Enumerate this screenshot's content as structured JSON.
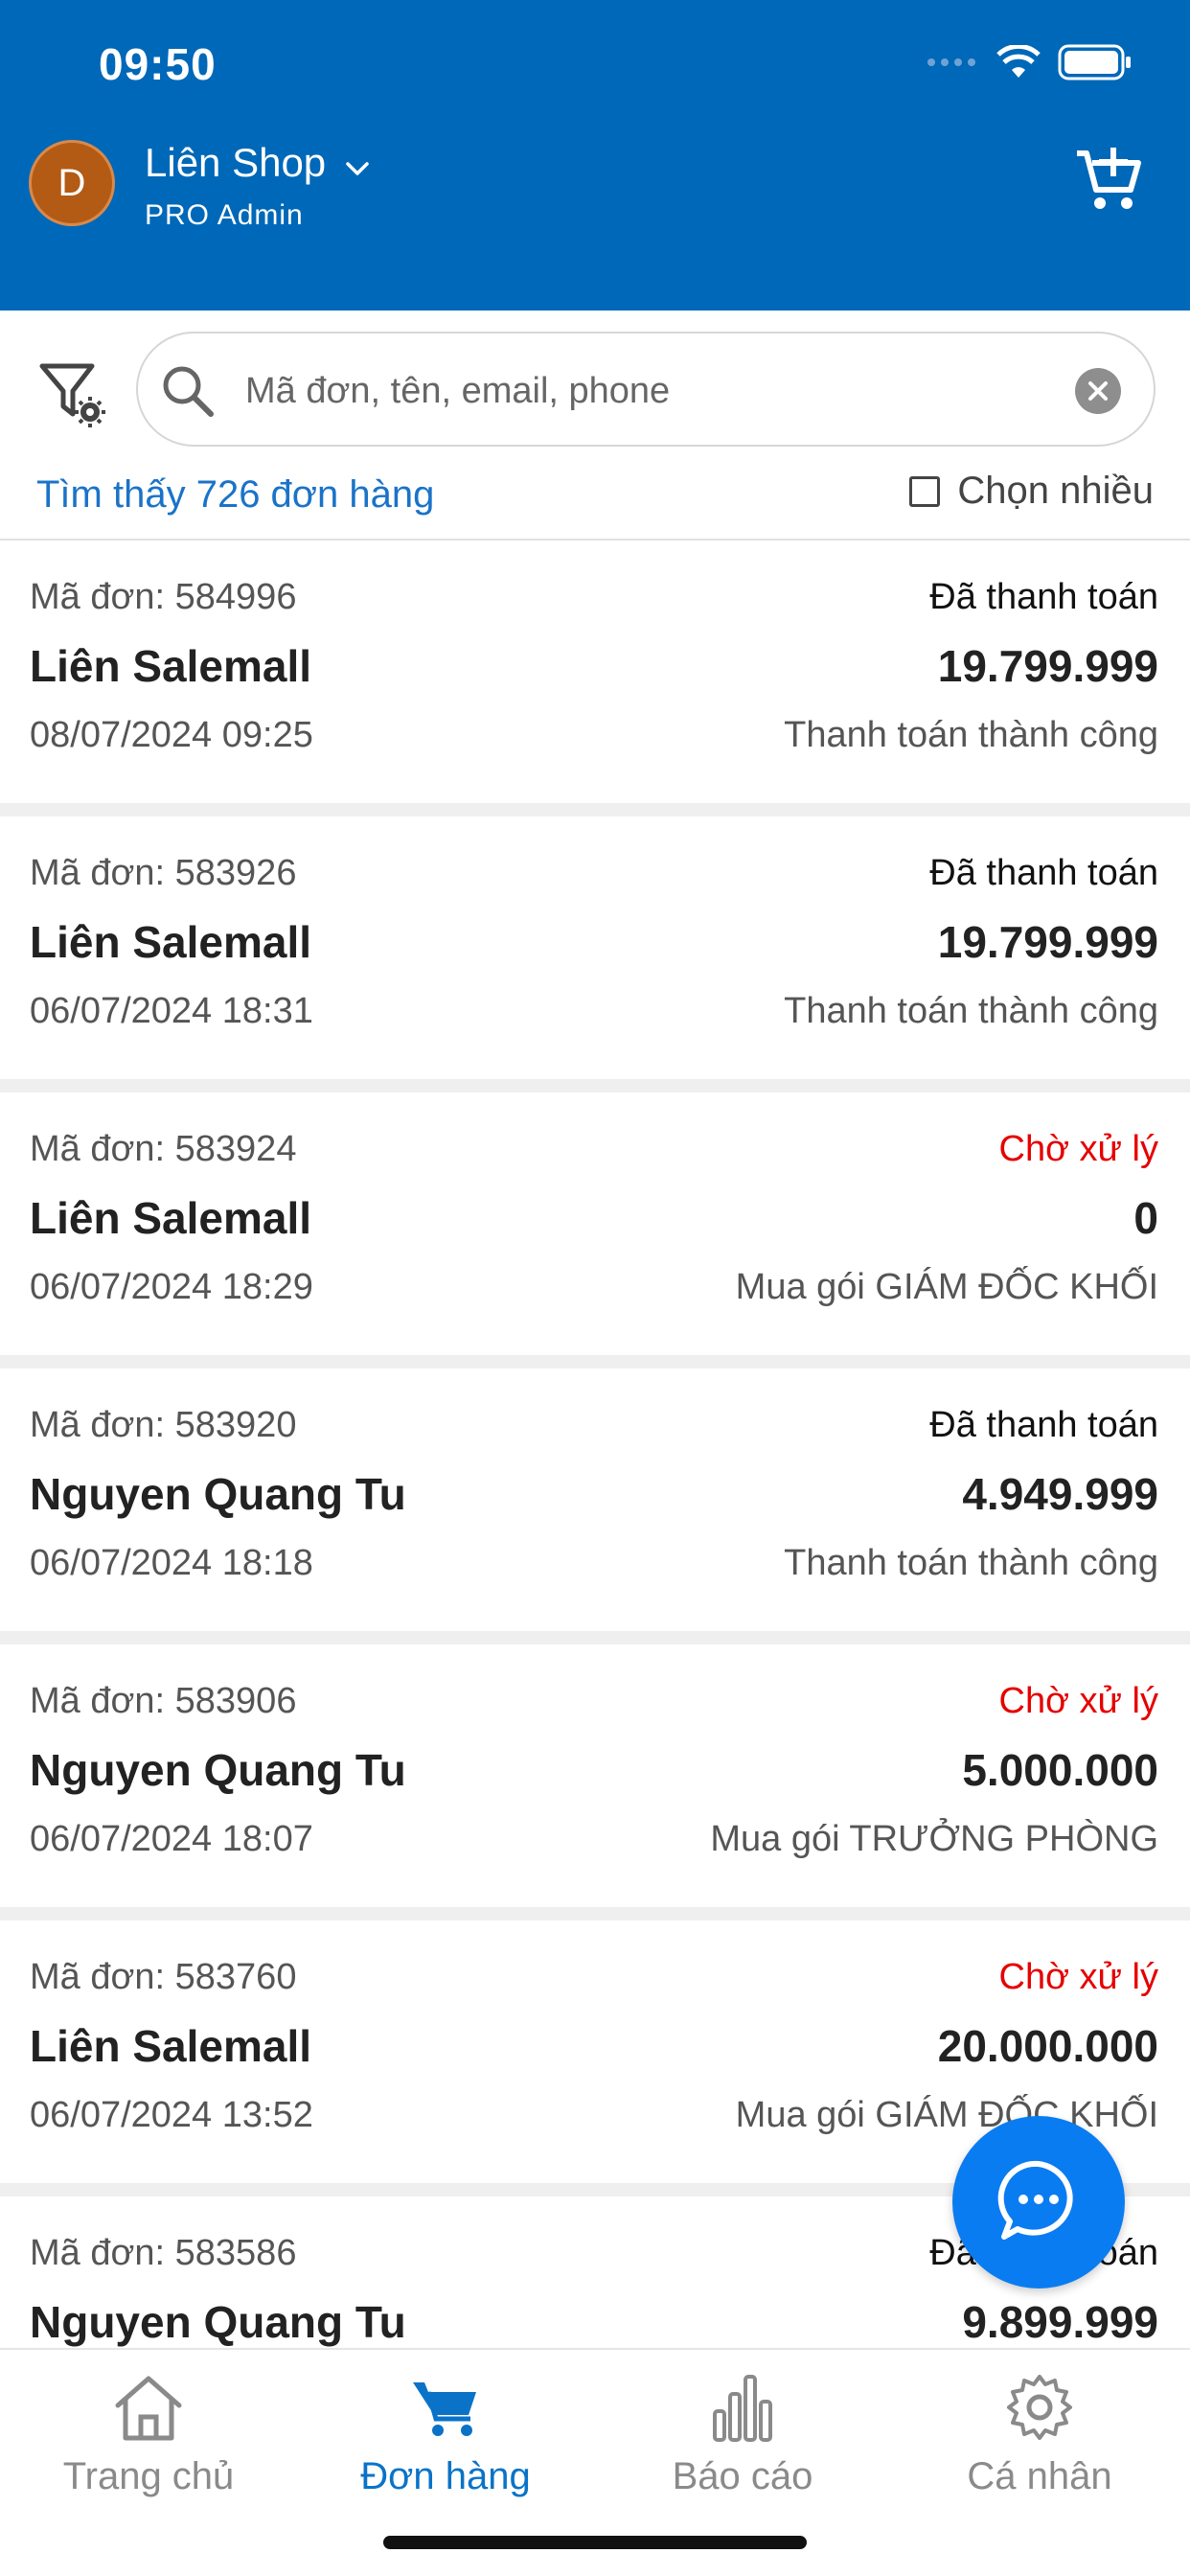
{
  "status_bar": {
    "time": "09:50"
  },
  "header": {
    "avatar_letter": "D",
    "shop_name": "Liên Shop",
    "role": "PRO  Admin"
  },
  "search": {
    "placeholder": "Mã đơn, tên, email, phone"
  },
  "summary": {
    "found_text": "Tìm thấy 726 đơn hàng",
    "multi_select_label": "Chọn nhiều"
  },
  "orders": [
    {
      "code": "Mã đơn: 584996",
      "status": "Đã thanh toán",
      "customer": "Liên Salemall",
      "amount": "19.799.999",
      "date": "08/07/2024 09:25",
      "note": "Thanh toán thành công"
    },
    {
      "code": "Mã đơn: 583926",
      "status": "Đã thanh toán",
      "customer": "Liên Salemall",
      "amount": "19.799.999",
      "date": "06/07/2024 18:31",
      "note": "Thanh toán thành công"
    },
    {
      "code": "Mã đơn: 583924",
      "status": "Chờ xử lý",
      "customer": "Liên Salemall",
      "amount": "0",
      "date": "06/07/2024 18:29",
      "note": "Mua gói GIÁM ĐỐC KHỐI"
    },
    {
      "code": "Mã đơn: 583920",
      "status": "Đã thanh toán",
      "customer": "Nguyen Quang Tu",
      "amount": "4.949.999",
      "date": "06/07/2024 18:18",
      "note": "Thanh toán thành công"
    },
    {
      "code": "Mã đơn: 583906",
      "status": "Chờ xử lý",
      "customer": "Nguyen Quang Tu",
      "amount": "5.000.000",
      "date": "06/07/2024 18:07",
      "note": "Mua gói TRƯỞNG PHÒNG"
    },
    {
      "code": "Mã đơn: 583760",
      "status": "Chờ xử lý",
      "customer": "Liên Salemall",
      "amount": "20.000.000",
      "date": "06/07/2024 13:52",
      "note": "Mua gói GIÁM ĐỐC KHỐI"
    },
    {
      "code": "Mã đơn: 583586",
      "status": "Đã thanh toán",
      "customer": "Nguyen Quang Tu",
      "amount": "9.899.999",
      "date": "",
      "note": ""
    }
  ],
  "status_colors": {
    "paid": "#111111",
    "pending": "#e60000"
  },
  "bottom_nav": [
    {
      "label": "Trang chủ",
      "icon": "home-icon"
    },
    {
      "label": "Đơn hàng",
      "icon": "cart-icon"
    },
    {
      "label": "Báo cáo",
      "icon": "bar-chart-icon"
    },
    {
      "label": "Cá nhân",
      "icon": "gear-icon"
    }
  ],
  "brand_color": "#0068b8",
  "accent_color": "#0a73c8"
}
